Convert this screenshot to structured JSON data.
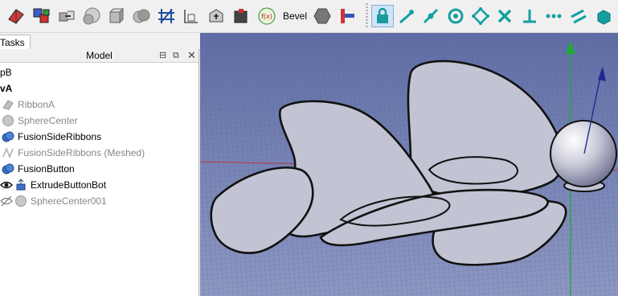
{
  "toolbar": {
    "bevel_label": "Bevel",
    "icons": [
      "box-icon",
      "boolean-icon",
      "shape-icon",
      "sphere-icon",
      "cube-icon",
      "fusion-icon",
      "sketch-icon",
      "shear-icon",
      "extrude-icon",
      "parameter-icon",
      "bevel-icon",
      "fillet-icon",
      "compound-icon",
      "lock-icon",
      "line-icon",
      "line-segment-icon",
      "circle-icon",
      "point-icon",
      "delete-icon",
      "perpendicular-icon",
      "ellipsis-icon",
      "parallel-icon",
      "block-icon"
    ]
  },
  "tabs": {
    "tasks": "Tasks"
  },
  "panel": {
    "title": "Model",
    "items": [
      {
        "label": "pB",
        "bold": false,
        "dim": false
      },
      {
        "label": "vA",
        "bold": true,
        "dim": false
      },
      {
        "label": "RibbonA",
        "dim": true
      },
      {
        "label": "SphereCenter",
        "dim": true
      },
      {
        "label": "FusionSideRibbons",
        "dim": false
      },
      {
        "label": "FusionSideRibbons (Meshed)",
        "dim": true
      },
      {
        "label": "FusionButton",
        "dim": false
      },
      {
        "label": "ExtrudeButtonBot",
        "dim": false
      },
      {
        "label": "SphereCenter001",
        "dim": true
      }
    ]
  },
  "colors": {
    "viewport_bg": "#6f7bb0",
    "shape_fill": "#c2c3d3",
    "axis_green": "#22aa33",
    "axis_red": "#cc2222",
    "axis_blue": "#1f2a90"
  }
}
